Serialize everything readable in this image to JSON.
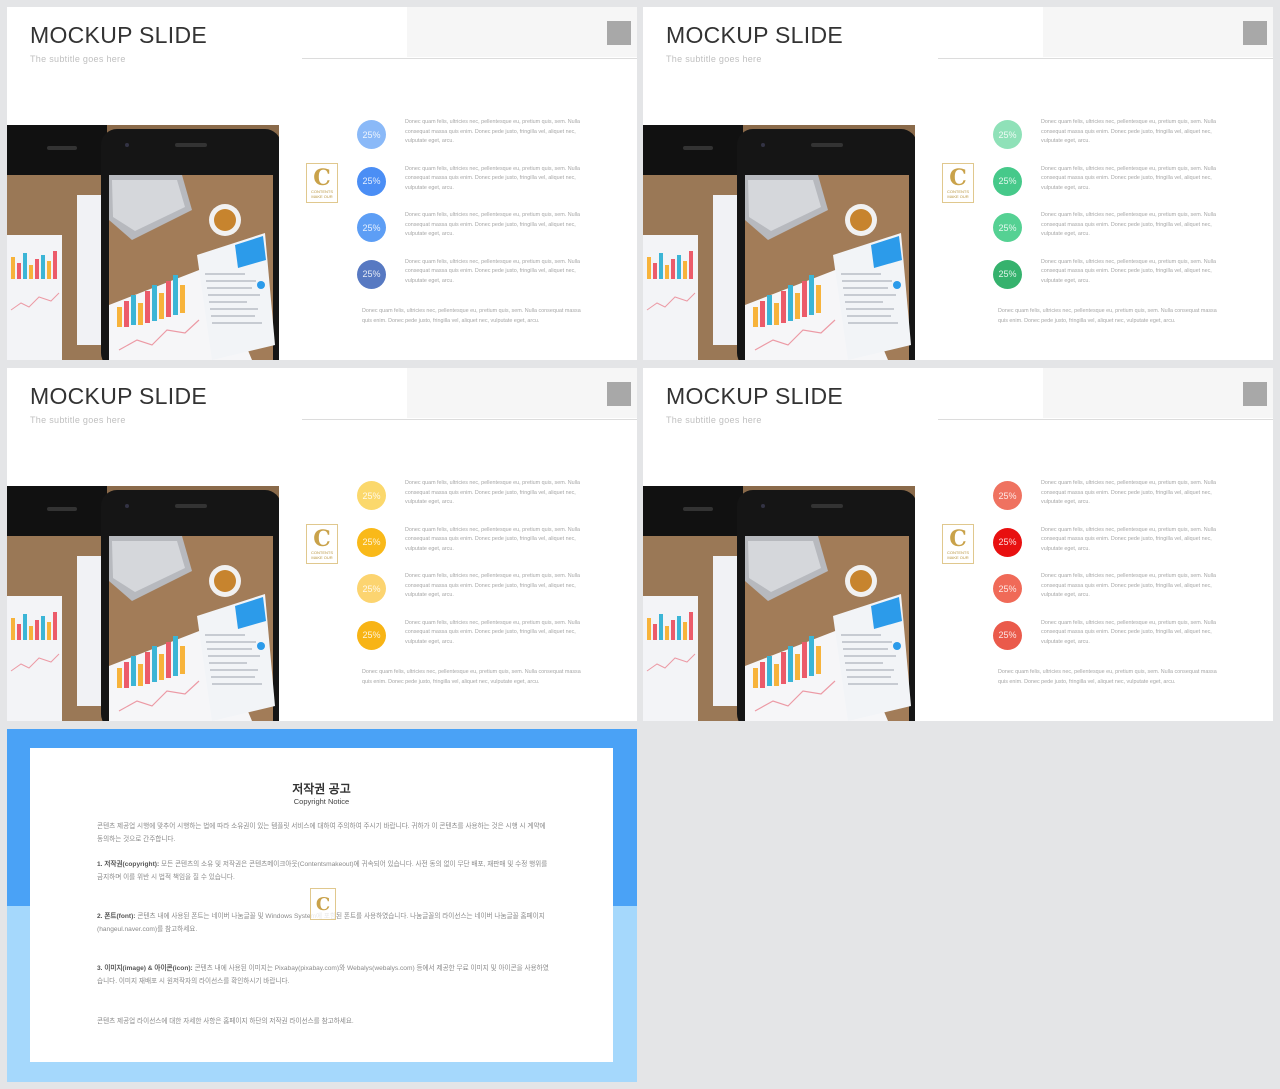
{
  "slides": [
    {
      "title": "MOCKUP SLIDE",
      "subtitle": "The subtitle goes here",
      "colors": [
        "#8ab9f8",
        "#4b8ef5",
        "#5d9ef5",
        "#5779c2"
      ]
    },
    {
      "title": "MOCKUP SLIDE",
      "subtitle": "The subtitle goes here",
      "colors": [
        "#8fe1b8",
        "#46c98a",
        "#55d193",
        "#35b26d"
      ]
    },
    {
      "title": "MOCKUP SLIDE",
      "subtitle": "The subtitle goes here",
      "colors": [
        "#fbd86c",
        "#f9b919",
        "#fcd470",
        "#f8b415"
      ]
    },
    {
      "title": "MOCKUP SLIDE",
      "subtitle": "The subtitle goes here",
      "colors": [
        "#ef7260",
        "#e81010",
        "#f06a58",
        "#ea5a4b"
      ]
    }
  ],
  "logo": {
    "letter": "C",
    "line1": "CONTENTS",
    "line2": "MAKE OUR"
  },
  "item_value": "25%",
  "item_text": "Donec quam felis, ultricies nec, pellentesque eu, pretium quis, sem. Nulla consequat massa quis enim. Donec pede justo, fringilla vel, aliquet nec, vulputate eget, arcu.",
  "footer_text": "Donec quam felis, ultricies nec, pellentesque eu, pretium quis, sem. Nulla consequat massa quis enim. Donec pede justo, fringilla vel, aliquet nec, vulputate eget, arcu.",
  "copyright": {
    "title": "저작권 공고",
    "subtitle": "Copyright Notice",
    "intro": "콘텐츠 제공업 시행에 맞추어 시행하는 법에 따라 소유권이 있는 템플릿 서비스에 대하여 주의하여 주시기 바랍니다. 귀하가 이 콘텐츠를 사용하는 것은 시행 시 계약에 동의하는 것으로 간주합니다.",
    "s1_label": "1. 저작권(copyright):",
    "s1_text": "모든 콘텐츠의 소유 및 저작권은 콘텐츠메이크아웃(Contentsmakeout)에 귀속되어 있습니다. 사전 동의 없이 무단 배포, 재판매 및 수정 행위를 금지하며 이를 위반 시 법적 책임을 질 수 있습니다.",
    "s2_label": "2. 폰트(font):",
    "s2_text": "콘텐츠 내에 사용된 폰트는 네이버 나눔글꼴 및 Windows System에 포함된 폰트를 사용하였습니다. 나눔글꼴의 라이선스는 네이버 나눔글꼴 홈페이지(hangeul.naver.com)를 참고하세요.",
    "s3_label": "3. 이미지(image) & 아이콘(icon):",
    "s3_text": "콘텐츠 내에 사용된 이미지는 Pixabay(pixabay.com)와 Webalys(webalys.com) 등에서 제공한 무료 이미지 및 아이콘을 사용하였습니다. 이미지 재배포 시 원저작자의 라이선스를 확인하시기 바랍니다.",
    "closing": "콘텐츠 제공업 라이선스에 대한 자세한 사항은 홈페이지 하단의 저작권 라이선스를 참고하세요."
  }
}
